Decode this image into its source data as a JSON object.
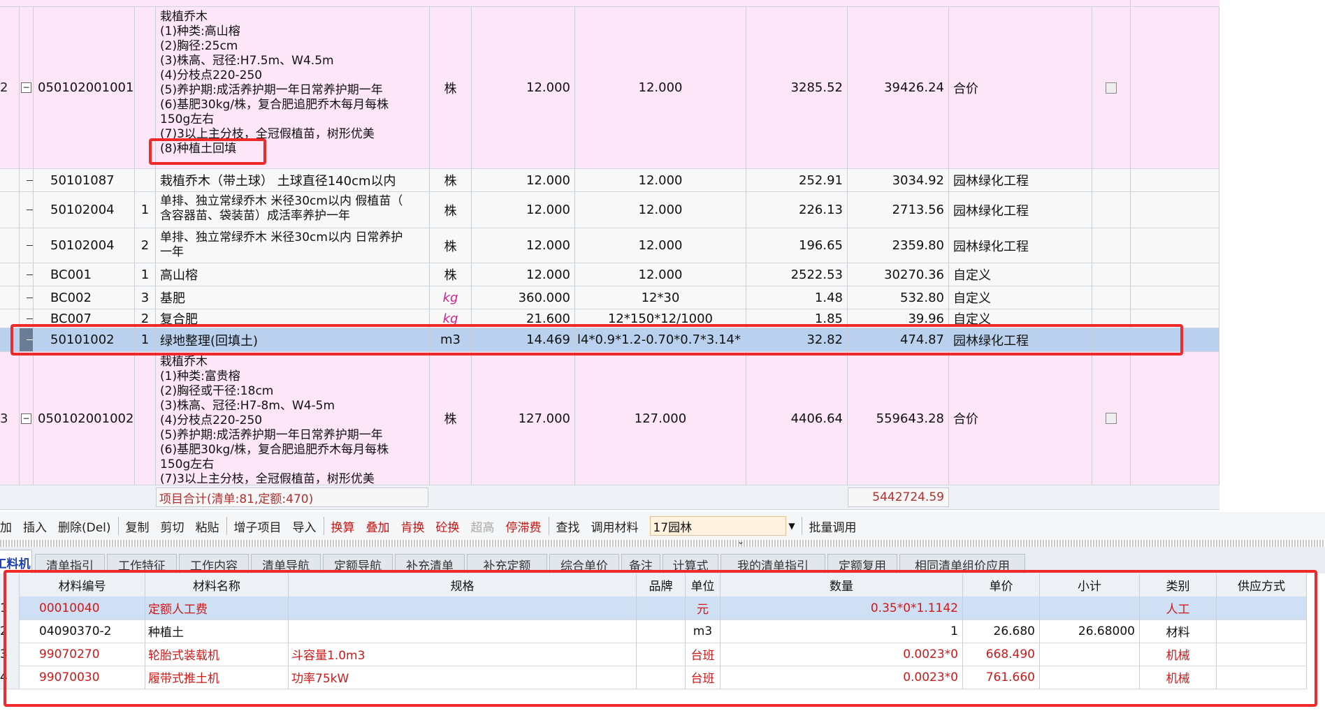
{
  "rows": [
    {
      "idx": "2",
      "code": "050102001001",
      "seq": "",
      "name_lines": [
        "栽植乔木",
        "(1)种类:高山榕",
        "(2)胸径:25cm",
        "(3)株高、冠径:H7.5m、W4.5m",
        "(4)分枝点220-250",
        "(5)养护期:成活养护期一年日常养护期一年",
        "(6)基肥30kg/株，复合肥追肥乔木每月每株",
        "150g左右",
        "(7)3以上主分枝，全冠假植苗，树形优美",
        "(8)种植土回填"
      ],
      "unit": "株",
      "qty": "12.000",
      "expr": "12.000",
      "price": "3285.52",
      "total": "39426.24",
      "type": "合价"
    },
    {
      "idx": "",
      "code": "50101087",
      "seq": "",
      "name": "栽植乔木（带土球） 土球直径140cm以内",
      "unit": "株",
      "qty": "12.000",
      "expr": "12.000",
      "price": "252.91",
      "total": "3034.92",
      "type": "园林绿化工程"
    },
    {
      "idx": "",
      "code": "50102004",
      "seq": "1",
      "name_lines": [
        "单排、独立常绿乔木 米径30cm以内 假植苗（",
        "含容器苗、袋装苗）成活率养护一年"
      ],
      "unit": "株",
      "qty": "12.000",
      "expr": "12.000",
      "price": "226.13",
      "total": "2713.56",
      "type": "园林绿化工程"
    },
    {
      "idx": "",
      "code": "50102004",
      "seq": "2",
      "name_lines": [
        "单排、独立常绿乔木 米径30cm以内 日常养护",
        "一年"
      ],
      "unit": "株",
      "qty": "12.000",
      "expr": "12.000",
      "price": "196.65",
      "total": "2359.80",
      "type": "园林绿化工程"
    },
    {
      "idx": "",
      "code": "BC001",
      "seq": "1",
      "name": "高山榕",
      "unit": "株",
      "qty": "12.000",
      "expr": "12.000",
      "price": "2522.53",
      "total": "30270.36",
      "type": "自定义"
    },
    {
      "idx": "",
      "code": "BC002",
      "seq": "3",
      "name": "基肥",
      "unit": "kg",
      "qty": "360.000",
      "expr": "12*30",
      "price": "1.48",
      "total": "532.80",
      "type": "自定义"
    },
    {
      "idx": "",
      "code": "BC007",
      "seq": "2",
      "name": "复合肥",
      "unit": "kg",
      "qty": "21.600",
      "expr": "12*150*12/1000",
      "price": "1.85",
      "total": "39.96",
      "type": "自定义"
    },
    {
      "idx": "",
      "code": "50101002",
      "seq": "1",
      "name": "绿地整理(回填土)",
      "unit": "m3",
      "qty": "14.469",
      "expr": "l4*0.9*1.2-0.70*0.7*3.14*",
      "price": "32.82",
      "total": "474.87",
      "type": "园林绿化工程"
    },
    {
      "idx": "3",
      "code": "050102001002",
      "seq": "",
      "name_lines": [
        "栽植乔木",
        "(1)种类:富贵榕",
        "(2)胸径或干径:18cm",
        "(3)株高、冠径:H7-8m、W4-5m",
        "(4)分枝点220-250",
        "(5)养护期:成活养护期一年日常养护期一年",
        "(6)基肥30kg/株，复合肥追肥乔木每月每株",
        "150g左右",
        "(7)3以上主分枝，全冠假植苗，树形优美"
      ],
      "unit": "株",
      "qty": "127.000",
      "expr": "127.000",
      "price": "4406.64",
      "total": "559643.28",
      "type": "合价"
    }
  ],
  "footer": {
    "item_summary": "项目合计(清单:81,定额:470)",
    "grand_total": "5442724.59"
  },
  "toolbar": {
    "items": [
      "加",
      "插入",
      "删除(Del)",
      "复制",
      "剪切",
      "粘贴",
      "增子项目",
      "导入",
      "换算",
      "叠加",
      "肯换",
      "砼换",
      "超高",
      "停滞费",
      "查找",
      "调用材料"
    ],
    "combo_value": "17园林",
    "batch": "批量调用"
  },
  "tabs": [
    "工料机",
    "清单指引",
    "工作特征",
    "工作内容",
    "清单导航",
    "定额导航",
    "补充清单",
    "补充定额",
    "综合单价",
    "备注",
    "计算式",
    "我的清单指引",
    "定额复用",
    "相同清单组价应用"
  ],
  "materials": {
    "headers": [
      "材料编号",
      "材料名称",
      "规格",
      "品牌",
      "单位",
      "数量",
      "单价",
      "小计",
      "类别",
      "供应方式"
    ],
    "rows": [
      {
        "no": "1",
        "code": "00010040",
        "name": "定额人工费",
        "spec": "",
        "brand": "",
        "unit": "元",
        "qty": "0.35*0*1.1142",
        "price": "",
        "subtotal": "",
        "cat": "人工",
        "supply": ""
      },
      {
        "no": "2",
        "code": "04090370-2",
        "name": "种植土",
        "spec": "",
        "brand": "",
        "unit": "m3",
        "qty": "1",
        "price": "26.680",
        "subtotal": "26.68000",
        "cat": "材料",
        "supply": ""
      },
      {
        "no": "3",
        "code": "99070270",
        "name": "轮胎式装载机",
        "spec": "斗容量1.0m3",
        "brand": "",
        "unit": "台班",
        "qty": "0.0023*0",
        "price": "668.490",
        "subtotal": "",
        "cat": "机械",
        "supply": ""
      },
      {
        "no": "4",
        "code": "99070030",
        "name": "履带式推土机",
        "spec": "功率75kW",
        "brand": "",
        "unit": "台班",
        "qty": "0.0023*0",
        "price": "761.660",
        "subtotal": "",
        "cat": "机械",
        "supply": ""
      }
    ]
  },
  "colors": {
    "highlight": "#f02a2a",
    "pink_row": "#fde6f8",
    "selected_row": "#b9d1ee",
    "red_text": "#d01818"
  }
}
